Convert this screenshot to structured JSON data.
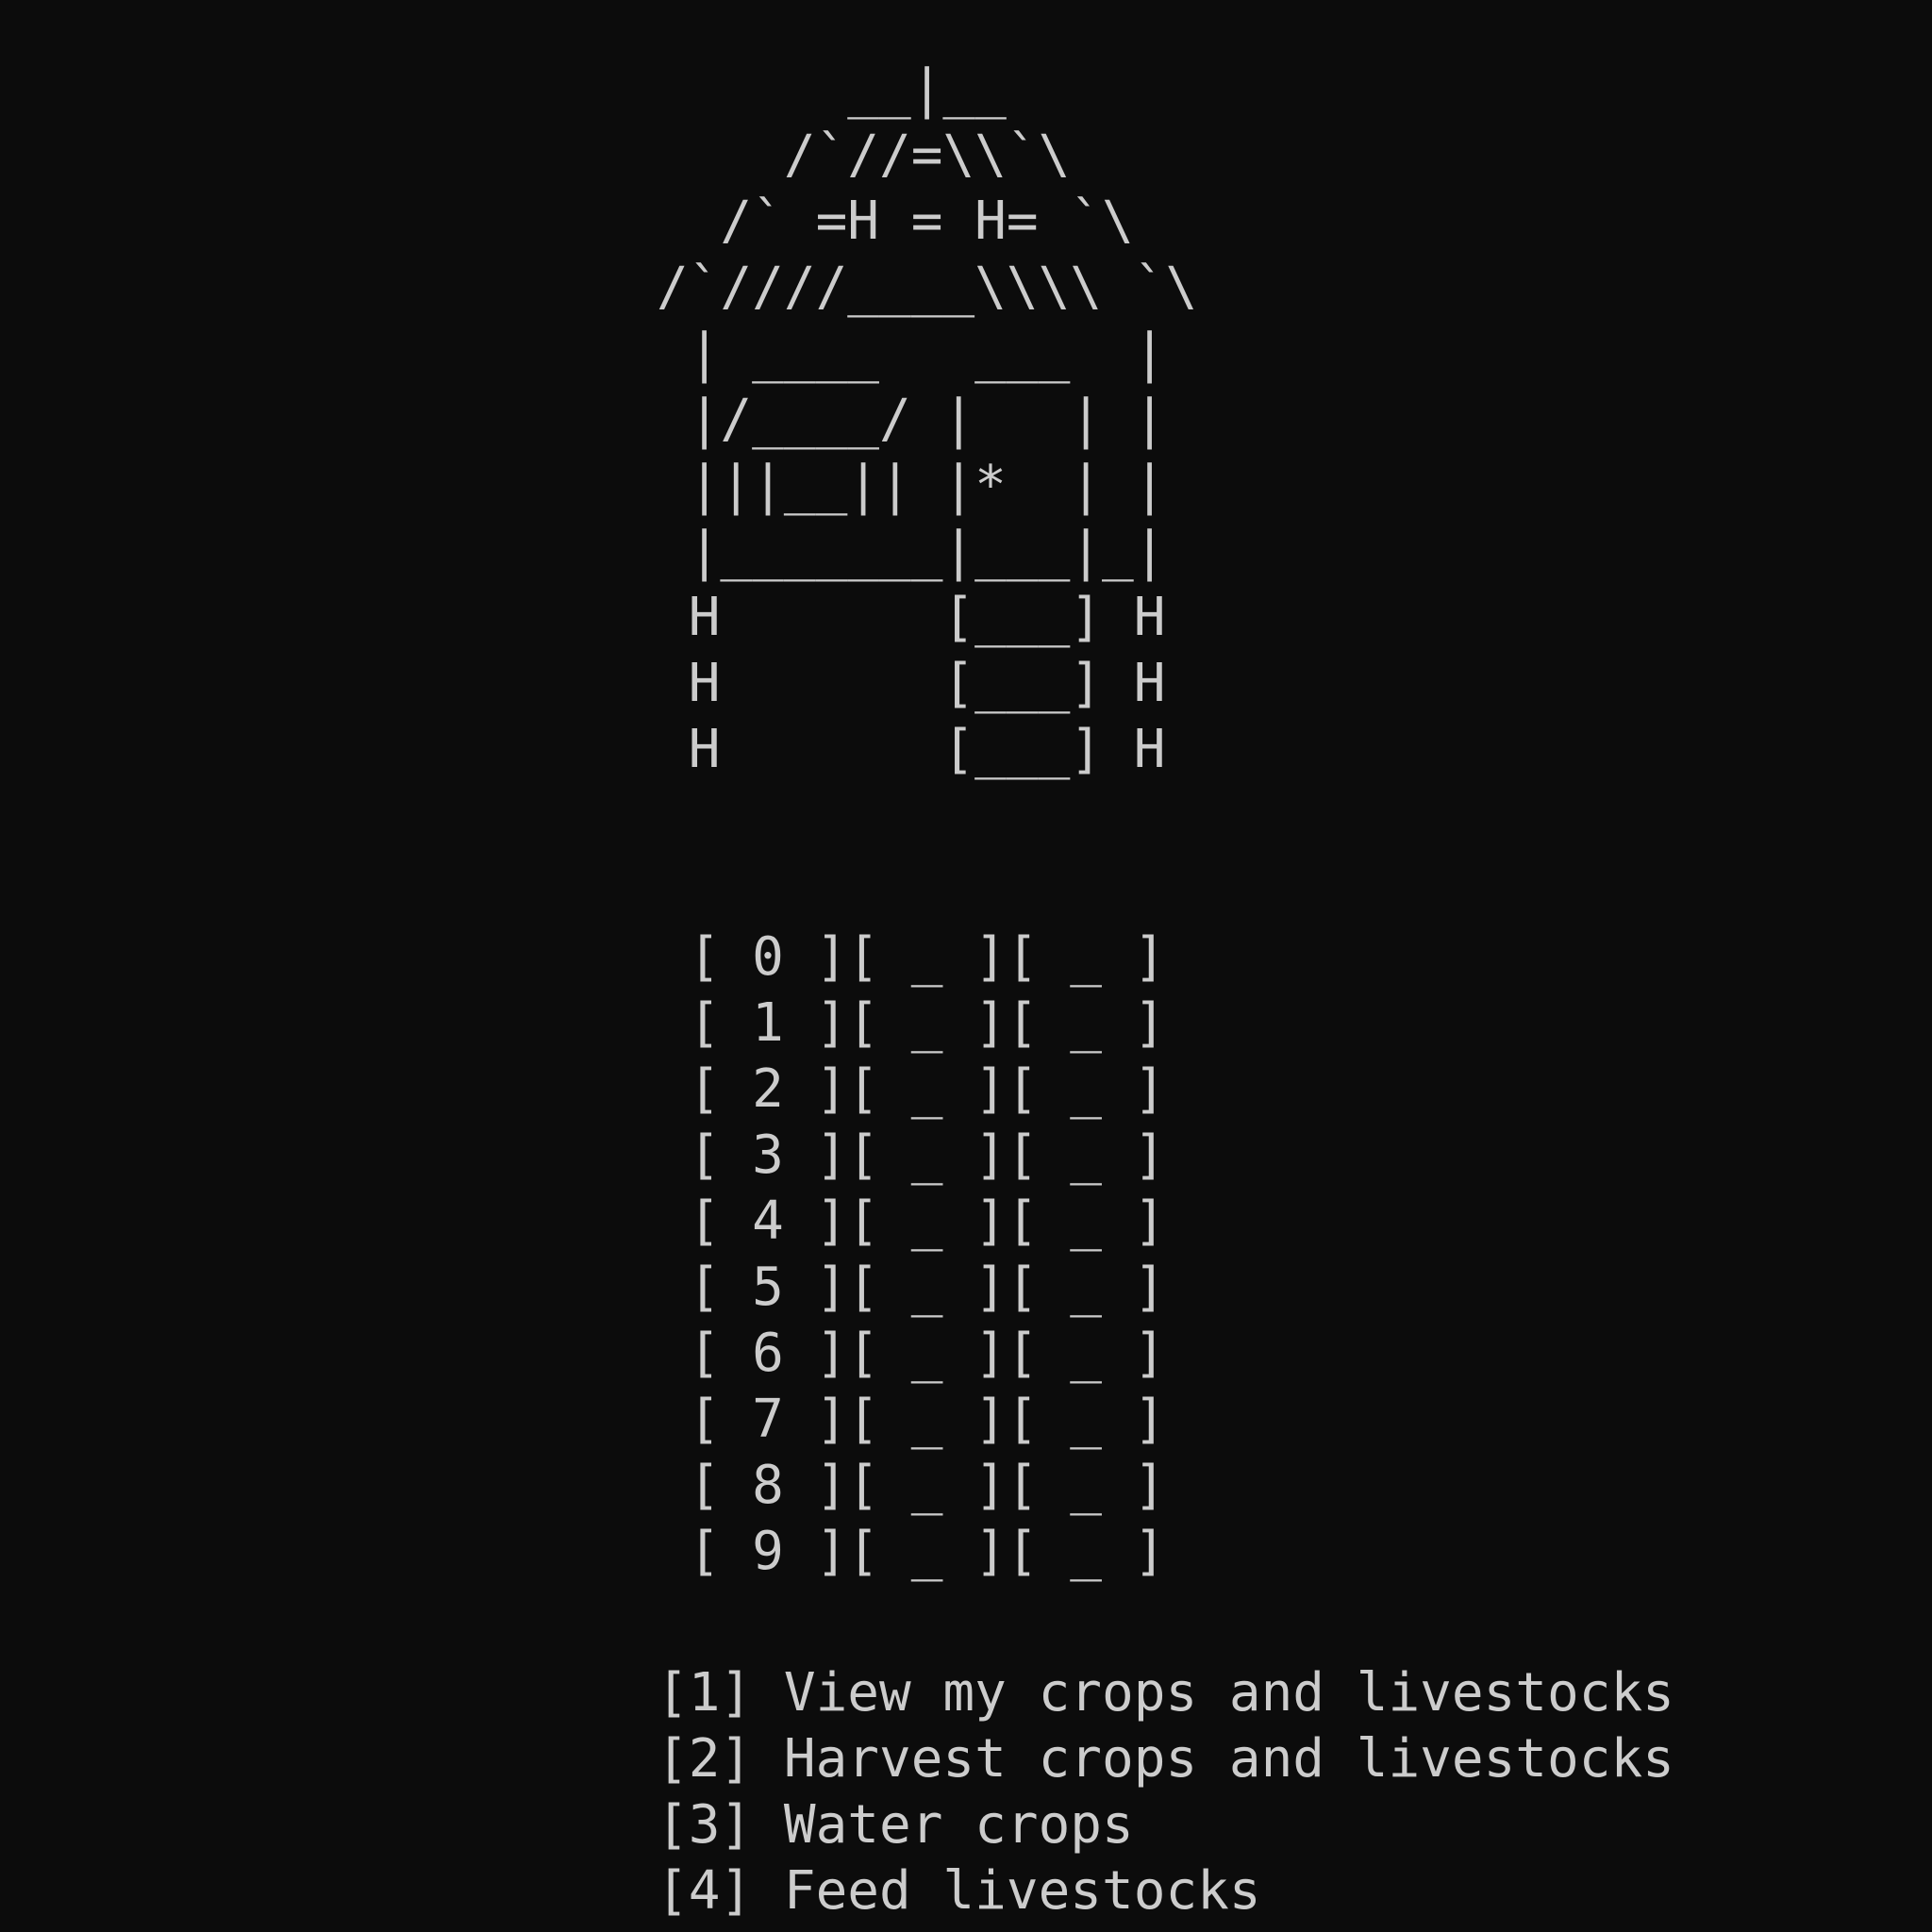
{
  "terminal": {
    "background": "#0c0c0c",
    "foreground": "#cccccc"
  },
  "house_art": [
    "      __|__",
    "    /`//=\\\\`\\",
    "  /` =H = H= `\\",
    "/`////____\\\\\\\\ `\\",
    " | ____   ___  |",
    " |/____/ |   | |",
    " |||__|| |*  | |",
    " |_______|___|_|",
    " H       [___] H",
    " H       [___] H",
    " H       [___] H"
  ],
  "grid": [
    " [ 0 ][ _ ][ _ ]",
    " [ 1 ][ _ ][ _ ]",
    " [ 2 ][ _ ][ _ ]",
    " [ 3 ][ _ ][ _ ]",
    " [ 4 ][ _ ][ _ ]",
    " [ 5 ][ _ ][ _ ]",
    " [ 6 ][ _ ][ _ ]",
    " [ 7 ][ _ ][ _ ]",
    " [ 8 ][ _ ][ _ ]",
    " [ 9 ][ _ ][ _ ]"
  ],
  "menu": [
    "[1] View my crops and livestocks",
    "[2] Harvest crops and livestocks",
    "[3] Water crops",
    "[4] Feed livestocks"
  ]
}
